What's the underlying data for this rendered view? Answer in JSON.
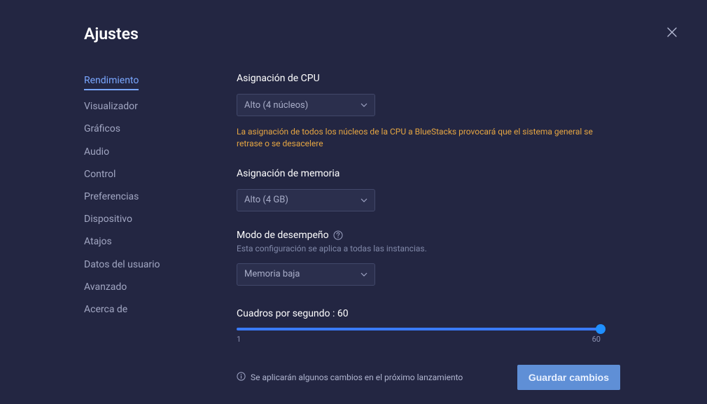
{
  "title": "Ajustes",
  "close_label": "Cerrar",
  "sidebar": {
    "items": [
      {
        "label": "Rendimiento",
        "active": true
      },
      {
        "label": "Visualizador"
      },
      {
        "label": "Gráficos"
      },
      {
        "label": "Audio"
      },
      {
        "label": "Control"
      },
      {
        "label": "Preferencias"
      },
      {
        "label": "Dispositivo"
      },
      {
        "label": "Atajos"
      },
      {
        "label": "Datos del usuario"
      },
      {
        "label": "Avanzado"
      },
      {
        "label": "Acerca de"
      }
    ]
  },
  "cpu": {
    "label": "Asignación de CPU",
    "value": "Alto (4 núcleos)",
    "warning": "La asignación de todos los núcleos de la CPU a BlueStacks provocará que el sistema general se retrase o se desacelere"
  },
  "memory": {
    "label": "Asignación de memoria",
    "value": "Alto (4 GB)"
  },
  "performance_mode": {
    "label": "Modo de desempeño",
    "sub": "Esta configuración se aplica a todas las instancias.",
    "value": "Memoria baja"
  },
  "fps": {
    "label_prefix": "Cuadros por segundo : ",
    "value": "60",
    "min": "1",
    "max": "60"
  },
  "footer": {
    "note": "Se aplicarán algunos cambios en el próximo lanzamiento",
    "save_label": "Guardar cambios"
  }
}
